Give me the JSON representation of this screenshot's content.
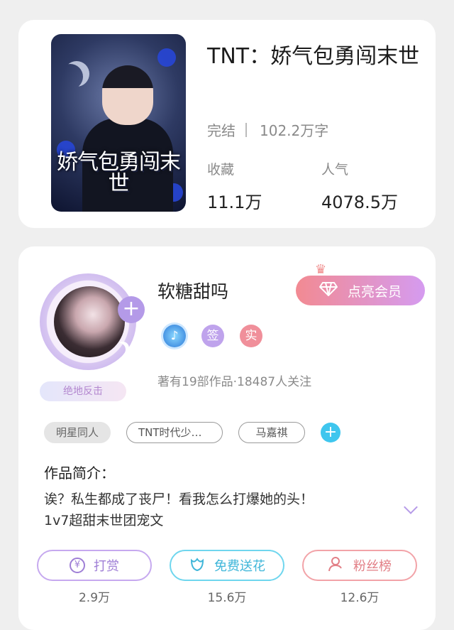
{
  "book": {
    "title": "TNT：娇气包勇闯末世",
    "cover_title": "娇气包勇闯末世",
    "status": "完结",
    "word_count": "102.2万字",
    "favorites_label": "收藏",
    "favorites_value": "11.1万",
    "popularity_label": "人气",
    "popularity_value": "4078.5万"
  },
  "author": {
    "name": "软糖甜吗",
    "vip_button": "点亮会员",
    "rank_badge": "绝地反击",
    "badges": [
      "music-note-icon",
      "签",
      "实"
    ],
    "info": "著有19部作品·18487人关注"
  },
  "tags": [
    "明星同人",
    "TNT时代少…",
    "马嘉祺"
  ],
  "intro": {
    "title": "作品简介：",
    "line1": "诶？私生都成了丧尸！看我怎么打爆她的头！",
    "line2": "1v7超甜末世团宠文"
  },
  "actions": {
    "reward_label": "打赏",
    "reward_count": "2.9万",
    "flower_label": "免费送花",
    "flower_count": "15.6万",
    "fans_label": "粉丝榜",
    "fans_count": "12.6万"
  },
  "colors": {
    "accent_purple": "#b49ae8",
    "accent_cyan": "#3fc6ee",
    "accent_pink": "#f28a92"
  }
}
